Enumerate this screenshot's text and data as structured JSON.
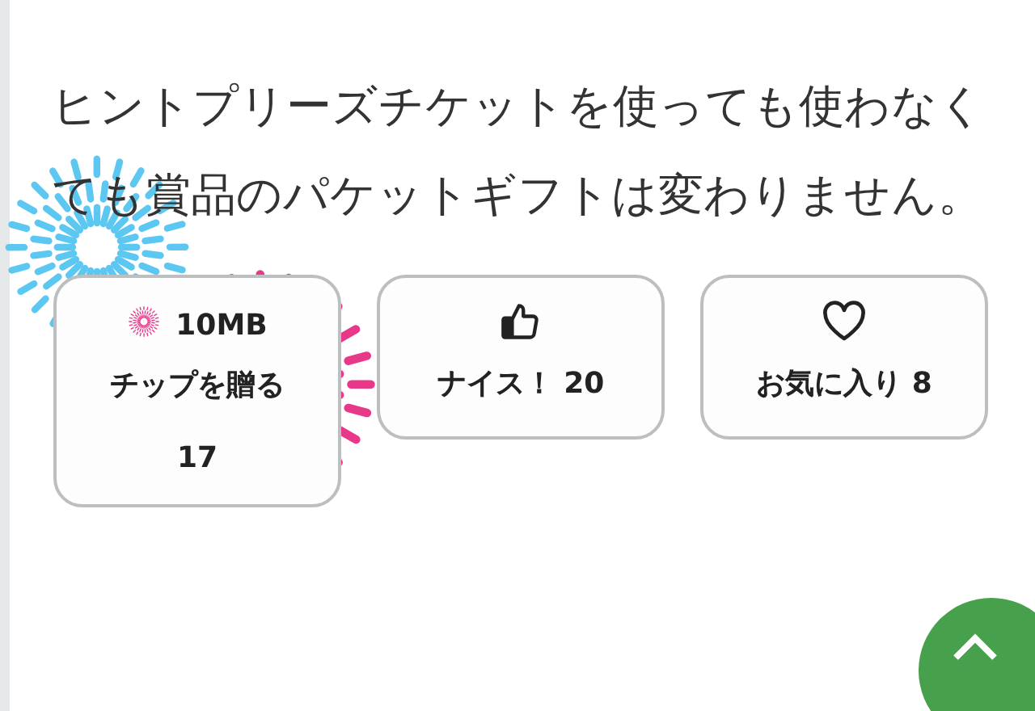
{
  "message": "ヒントプリーズチケットを使っても使わなくても賞品のパケットギフトは変わりません。",
  "actions": [
    {
      "kind": "tip",
      "amount": "10MB",
      "label": "チップを贈る",
      "count": "17"
    },
    {
      "kind": "like",
      "label": "ナイス！",
      "count": "20"
    },
    {
      "kind": "favorite",
      "label": "お気に入り",
      "count": "8"
    }
  ]
}
